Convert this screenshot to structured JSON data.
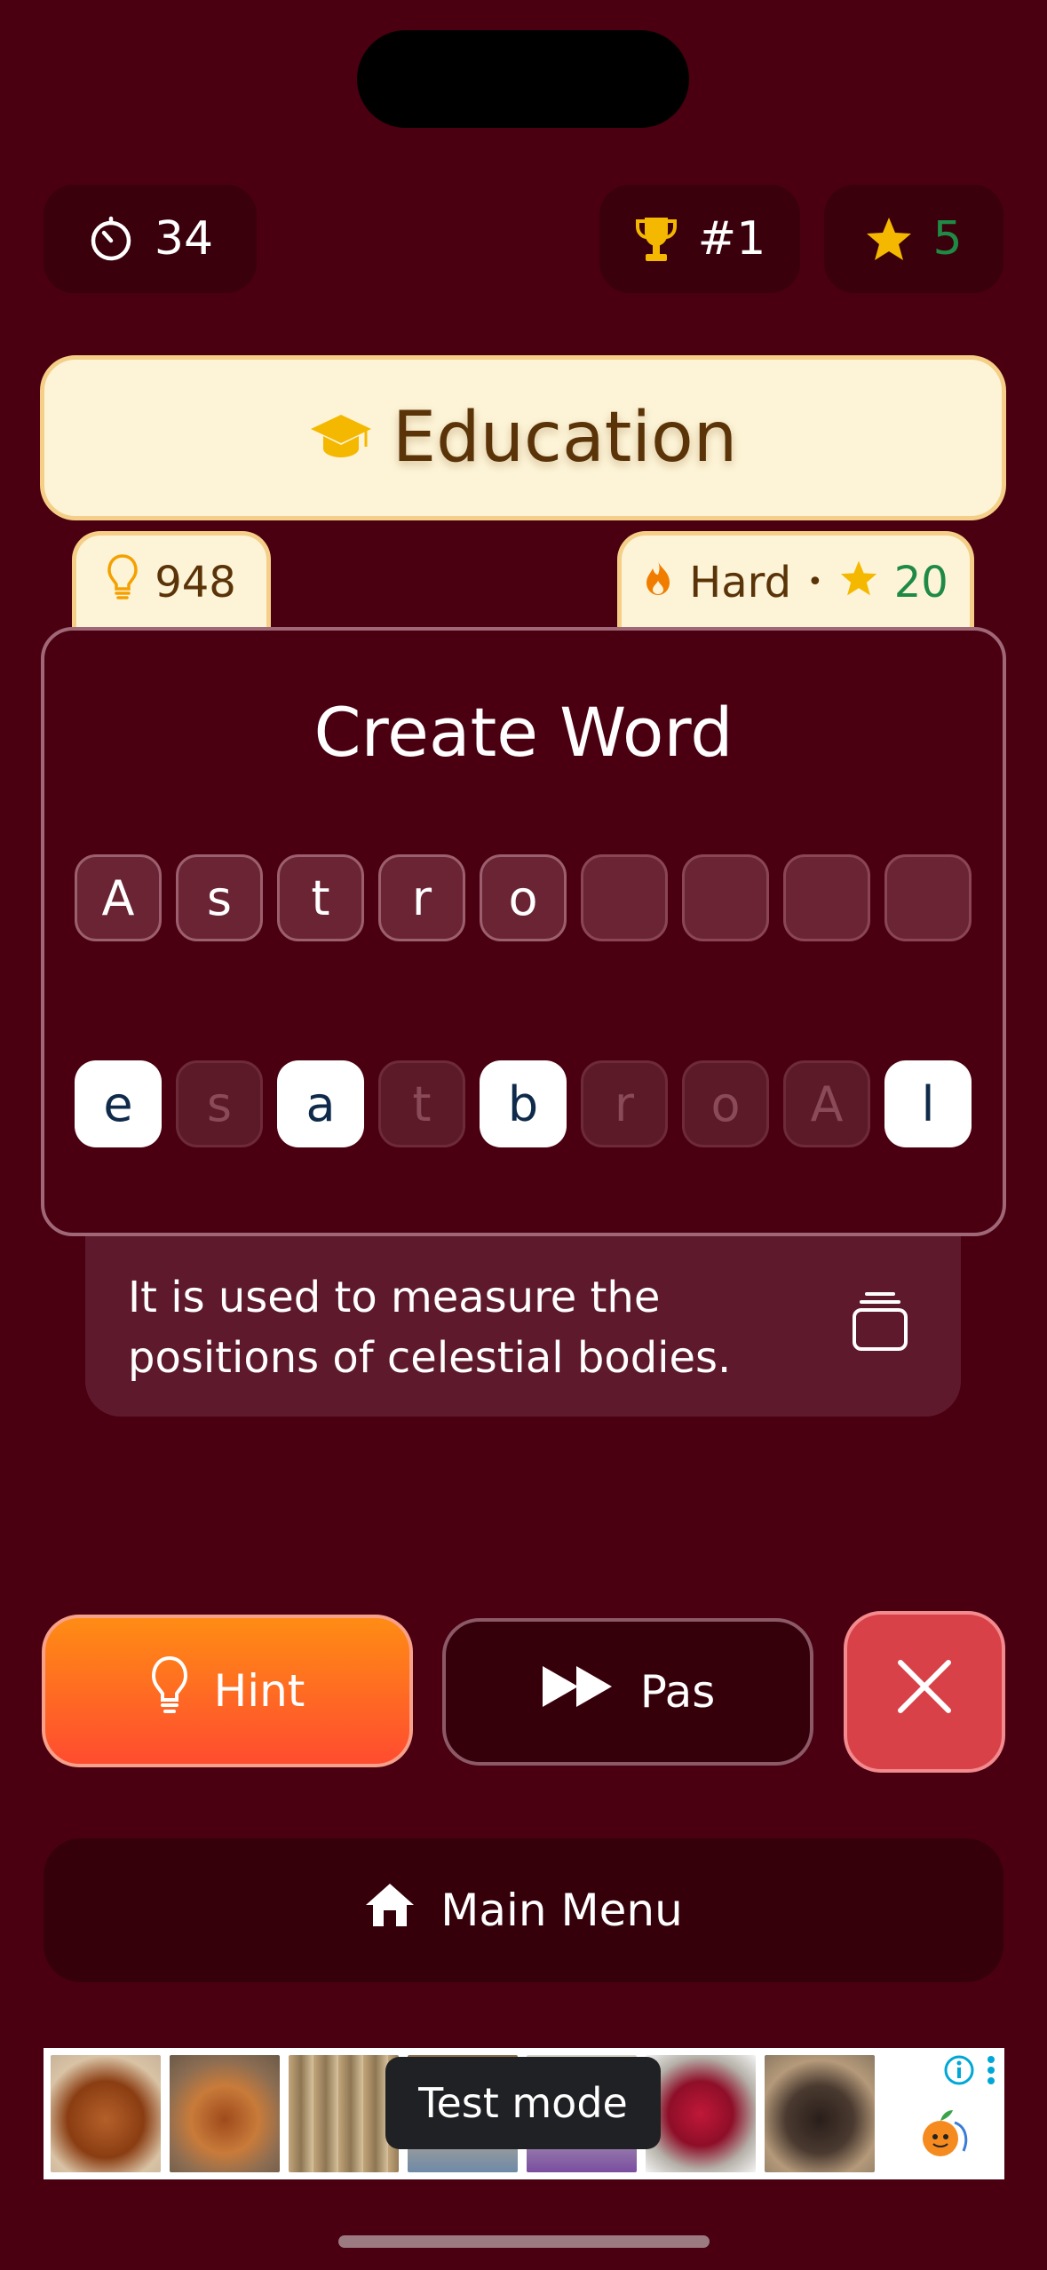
{
  "status": {
    "timer": "34",
    "rank": "#1",
    "stars": "5"
  },
  "category": {
    "title": "Education",
    "icon": "graduation-cap-icon"
  },
  "tags": {
    "hints": "948",
    "difficulty": "Hard",
    "separator": "•",
    "points": "20"
  },
  "puzzle": {
    "title": "Create Word",
    "answer_tiles": [
      "A",
      "s",
      "t",
      "r",
      "o",
      "",
      "",
      "",
      ""
    ],
    "letter_tiles": [
      {
        "letter": "e",
        "state": "available"
      },
      {
        "letter": "s",
        "state": "used"
      },
      {
        "letter": "a",
        "state": "available"
      },
      {
        "letter": "t",
        "state": "used"
      },
      {
        "letter": "b",
        "state": "available"
      },
      {
        "letter": "r",
        "state": "used"
      },
      {
        "letter": "o",
        "state": "used"
      },
      {
        "letter": "A",
        "state": "used"
      },
      {
        "letter": "l",
        "state": "available"
      }
    ]
  },
  "clue": {
    "line1": "It is used to measure the",
    "line2": "positions of celestial bodies."
  },
  "actions": {
    "hint_label": "Hint",
    "pass_label": "Pas",
    "menu_label": "Main Menu"
  },
  "ad": {
    "label": "Test mode"
  },
  "colors": {
    "background": "#4a0011",
    "category_bg": "#fdf4d7",
    "hint_gradient_top": "#ff8c14",
    "hint_gradient_bottom": "#ff4c30",
    "close_bg": "#d94148",
    "stars_text": "#1f8a45",
    "gold": "#f5b800"
  }
}
